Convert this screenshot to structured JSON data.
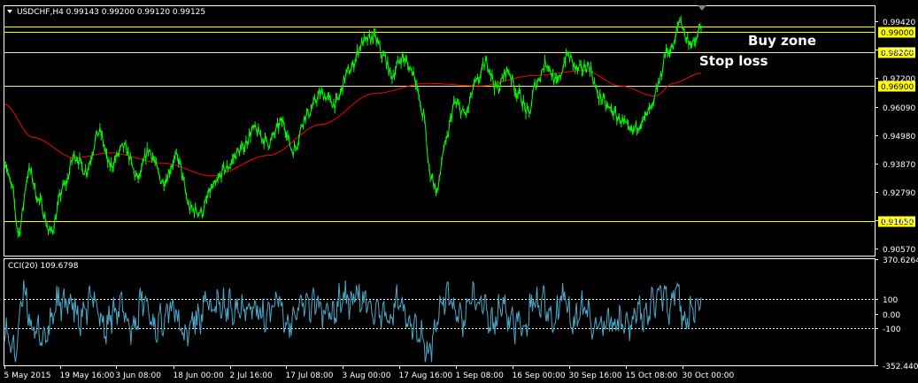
{
  "chart_data": [
    {
      "type": "line",
      "title": "USDCHF,H4  0.99143 0.99200 0.99120 0.99125",
      "symbol": "USDCHF",
      "timeframe": "H4",
      "ohlc": {
        "open": "0.99143",
        "high": "0.99200",
        "low": "0.99120",
        "close": "0.99125"
      },
      "ylim": [
        0.903,
        1.0
      ],
      "y_tick_labels": [
        "0.99420",
        "0.98310",
        "0.97200",
        "0.96090",
        "0.94980",
        "0.93870",
        "0.92790",
        "0.91680",
        "0.90570"
      ],
      "y_tick_values": [
        0.9942,
        0.9831,
        0.972,
        0.9609,
        0.9498,
        0.9387,
        0.9279,
        0.9168,
        0.9057
      ],
      "x_tick_labels": [
        "5 May 2015",
        "19 May 16:00",
        "3 Jun 08:00",
        "18 Jun 00:00",
        "2 Jul 16:00",
        "17 Jul 08:00",
        "3 Aug 00:00",
        "17 Aug 16:00",
        "1 Sep 08:00",
        "16 Sep 00:00",
        "30 Sep 16:00",
        "15 Oct 08:00",
        "30 Oct 00:00"
      ],
      "horizontal_levels": [
        {
          "value": 0.992,
          "label": ""
        },
        {
          "value": 0.99,
          "label": "0.99000"
        },
        {
          "value": 0.982,
          "label": "0.98200"
        },
        {
          "value": 0.969,
          "label": "0.96900"
        },
        {
          "value": 0.9165,
          "label": "0.91650"
        }
      ],
      "annotations": [
        {
          "text": "Buy zone",
          "value": 0.9865
        },
        {
          "text": "Stop loss",
          "value": 0.9787
        }
      ],
      "price_anchors": [
        [
          0,
          0.94
        ],
        [
          2,
          0.93
        ],
        [
          4,
          0.912
        ],
        [
          7,
          0.936
        ],
        [
          10,
          0.924
        ],
        [
          13,
          0.912
        ],
        [
          17,
          0.93
        ],
        [
          20,
          0.942
        ],
        [
          23,
          0.936
        ],
        [
          27,
          0.951
        ],
        [
          30,
          0.938
        ],
        [
          34,
          0.945
        ],
        [
          38,
          0.933
        ],
        [
          41,
          0.944
        ],
        [
          45,
          0.932
        ],
        [
          49,
          0.941
        ],
        [
          53,
          0.921
        ],
        [
          56,
          0.92
        ],
        [
          59,
          0.929
        ],
        [
          63,
          0.937
        ],
        [
          67,
          0.944
        ],
        [
          71,
          0.952
        ],
        [
          75,
          0.947
        ],
        [
          79,
          0.955
        ],
        [
          82,
          0.944
        ],
        [
          86,
          0.958
        ],
        [
          90,
          0.966
        ],
        [
          94,
          0.962
        ],
        [
          98,
          0.975
        ],
        [
          102,
          0.986
        ],
        [
          105,
          0.988
        ],
        [
          108,
          0.98
        ],
        [
          110,
          0.973
        ],
        [
          113,
          0.98
        ],
        [
          116,
          0.975
        ],
        [
          119,
          0.958
        ],
        [
          121,
          0.935
        ],
        [
          123,
          0.928
        ],
        [
          125,
          0.945
        ],
        [
          128,
          0.962
        ],
        [
          131,
          0.958
        ],
        [
          134,
          0.97
        ],
        [
          137,
          0.978
        ],
        [
          140,
          0.968
        ],
        [
          143,
          0.975
        ],
        [
          146,
          0.966
        ],
        [
          149,
          0.958
        ],
        [
          151,
          0.97
        ],
        [
          154,
          0.978
        ],
        [
          157,
          0.97
        ],
        [
          160,
          0.981
        ],
        [
          163,
          0.975
        ],
        [
          166,
          0.977
        ],
        [
          169,
          0.965
        ],
        [
          172,
          0.96
        ],
        [
          175,
          0.956
        ],
        [
          178,
          0.951
        ],
        [
          181,
          0.955
        ],
        [
          184,
          0.96
        ],
        [
          186,
          0.97
        ],
        [
          188,
          0.982
        ],
        [
          190,
          0.984
        ],
        [
          192,
          0.995
        ],
        [
          194,
          0.987
        ],
        [
          196,
          0.985
        ],
        [
          198,
          0.992
        ]
      ],
      "price_last_index": 198,
      "moving_average_anchors": [
        [
          0,
          0.962
        ],
        [
          8,
          0.949
        ],
        [
          20,
          0.941
        ],
        [
          30,
          0.943
        ],
        [
          45,
          0.939
        ],
        [
          59,
          0.934
        ],
        [
          75,
          0.942
        ],
        [
          90,
          0.954
        ],
        [
          105,
          0.966
        ],
        [
          120,
          0.97
        ],
        [
          135,
          0.969
        ],
        [
          150,
          0.973
        ],
        [
          165,
          0.975
        ],
        [
          175,
          0.969
        ],
        [
          185,
          0.965
        ],
        [
          190,
          0.97
        ],
        [
          198,
          0.974
        ]
      ],
      "colors": {
        "price": "#00ff00",
        "moving_average": "#ff0000",
        "levels": "#ffff00",
        "grid": "#ffffff"
      }
    },
    {
      "type": "line",
      "title": "CCI(20) 109.6798",
      "indicator": "CCI",
      "period": 20,
      "current_value": "109.6798",
      "ylim": [
        -352.44,
        370.6264
      ],
      "y_tick_labels": [
        "370.6264",
        "100",
        "0.00",
        "-100",
        "-352.4400"
      ],
      "y_tick_values": [
        370.6264,
        100,
        0,
        -100,
        -352.44
      ],
      "levels": [
        100,
        -100
      ],
      "colors": {
        "line": "#4aa8c8",
        "levels": "#ffffff"
      }
    }
  ]
}
